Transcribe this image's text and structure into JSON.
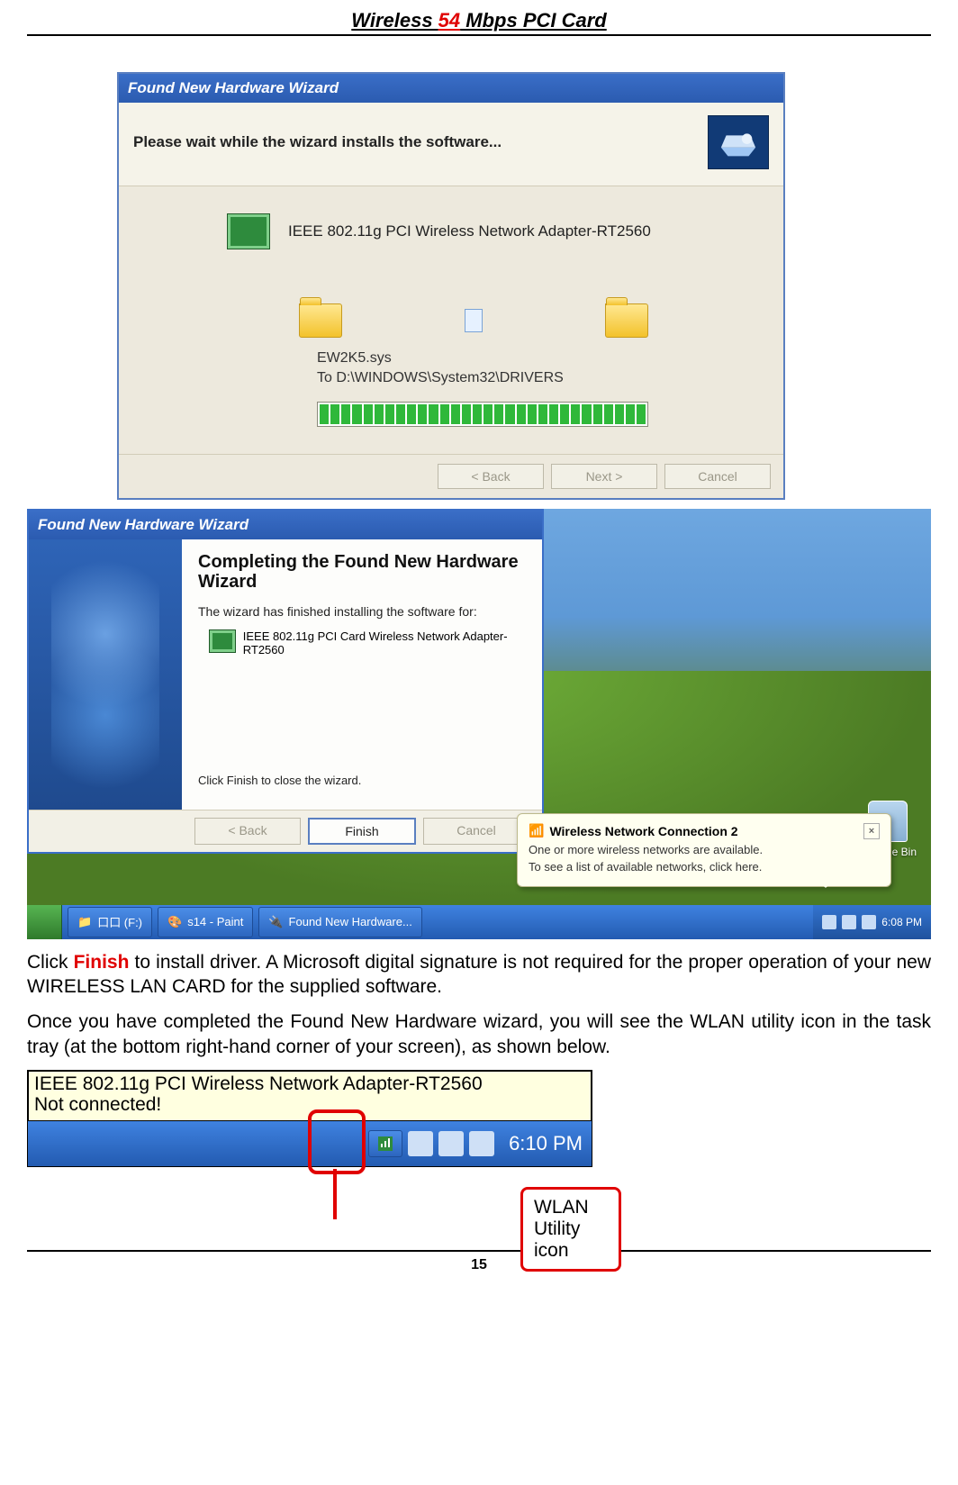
{
  "doc_header": {
    "pre": "Wireless ",
    "red": "54",
    "post": " Mbps PCI Card"
  },
  "page_number": "15",
  "wizard1": {
    "title": "Found New Hardware Wizard",
    "instruction": "Please wait while the wizard installs the software...",
    "device": "IEEE 802.11g PCI  Wireless Network Adapter-RT2560",
    "file": "EW2K5.sys",
    "dest": "To D:\\WINDOWS\\System32\\DRIVERS",
    "btn_back": "< Back",
    "btn_next": "Next >",
    "btn_cancel": "Cancel"
  },
  "wizard2": {
    "title": "Found New Hardware Wizard",
    "heading": "Completing the Found New Hardware Wizard",
    "msg": "The wizard has finished installing the software for:",
    "device": "IEEE 802.11g PCI Card  Wireless Network Adapter-RT2560",
    "close_hint": "Click Finish to close the wizard.",
    "btn_back": "< Back",
    "btn_finish": "Finish",
    "btn_cancel": "Cancel"
  },
  "balloon": {
    "title": "Wireless Network Connection 2",
    "line1": "One or more wireless networks are available.",
    "line2": "To see a list of available networks, click here."
  },
  "desktop": {
    "recycle": "Recycle Bin",
    "task1": "口口 (F:)",
    "task2": "s14 - Paint",
    "task3": "Found New Hardware...",
    "clock": "6:08 PM"
  },
  "paragraph1": {
    "pre": "Click ",
    "red": "Finish",
    "post": " to install driver.  A Microsoft digital signature is not required for the proper operation of your new WIRELESS LAN CARD for the supplied software."
  },
  "paragraph2": "Once you have completed the Found New Hardware wizard, you will see the WLAN utility icon in the task tray (at the bottom right-hand corner of your screen), as shown below.",
  "tray_shot": {
    "tooltip_line1": "IEEE 802.11g PCI  Wireless Network Adapter-RT2560",
    "tooltip_line2": "Not connected!",
    "clock": "6:10 PM"
  },
  "callout": "WLAN Utility icon"
}
